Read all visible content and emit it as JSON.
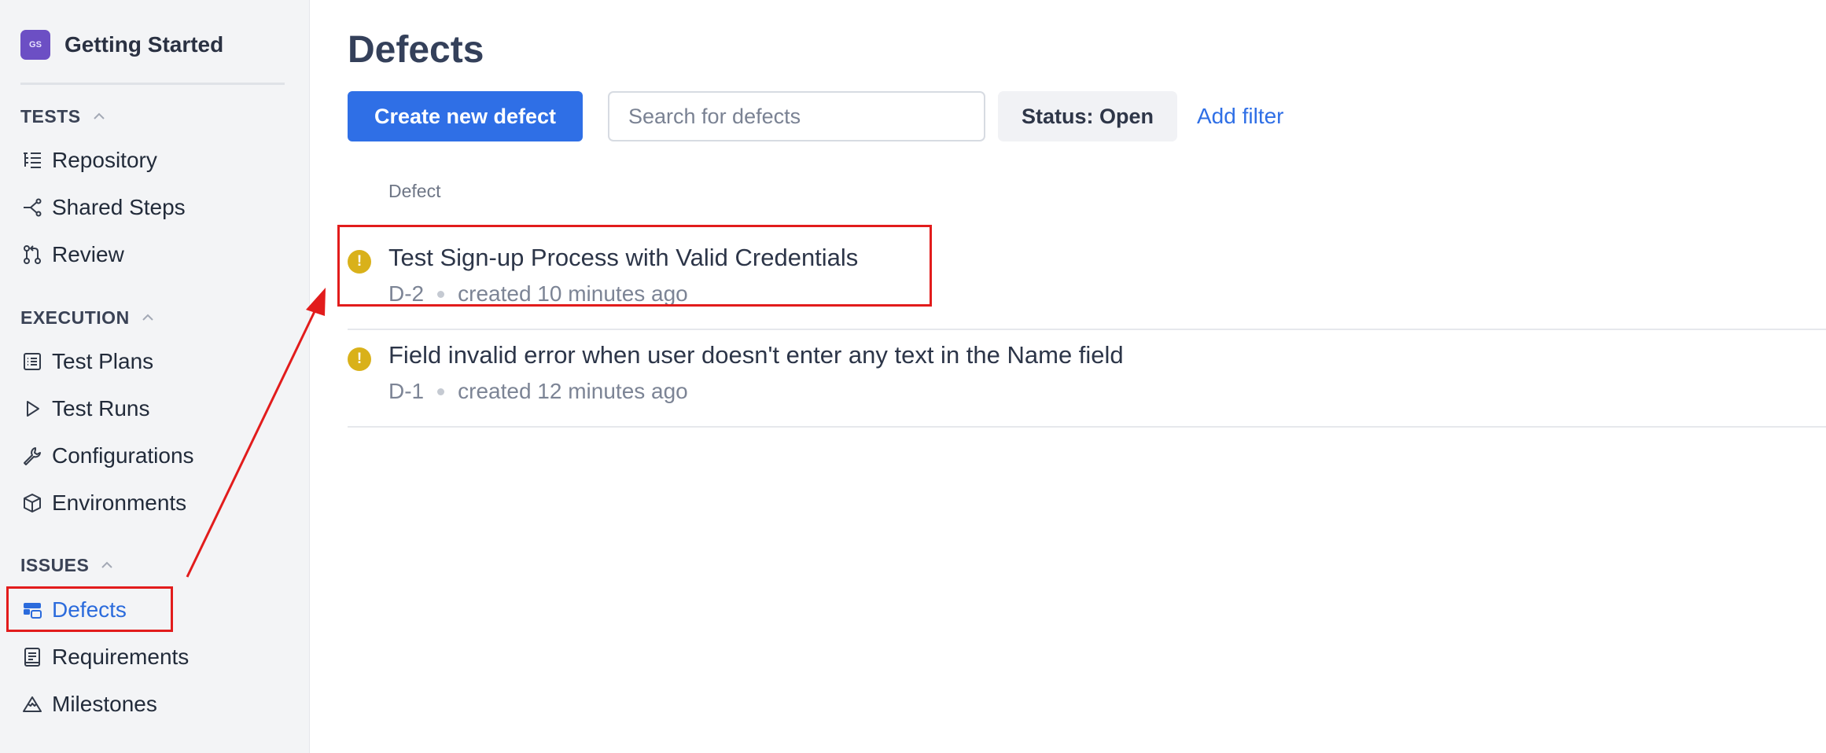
{
  "project": {
    "initials": "GS",
    "name": "Getting Started"
  },
  "sidebar": {
    "sections": [
      {
        "title": "TESTS",
        "items": [
          {
            "label": "Repository",
            "icon": "tree-list-icon"
          },
          {
            "label": "Shared Steps",
            "icon": "share-steps-icon"
          },
          {
            "label": "Review",
            "icon": "git-pull-request-icon"
          }
        ]
      },
      {
        "title": "EXECUTION",
        "items": [
          {
            "label": "Test Plans",
            "icon": "list-box-icon"
          },
          {
            "label": "Test Runs",
            "icon": "play-icon"
          },
          {
            "label": "Configurations",
            "icon": "wrench-icon"
          },
          {
            "label": "Environments",
            "icon": "cube-icon"
          }
        ]
      },
      {
        "title": "ISSUES",
        "items": [
          {
            "label": "Defects",
            "icon": "defects-icon",
            "active": true
          },
          {
            "label": "Requirements",
            "icon": "document-icon"
          },
          {
            "label": "Milestones",
            "icon": "mountain-icon"
          }
        ]
      }
    ]
  },
  "main": {
    "title": "Defects",
    "create_button": "Create new defect",
    "search_placeholder": "Search for defects",
    "status_filter": "Status: Open",
    "add_filter": "Add filter",
    "column_header": "Defect",
    "defects": [
      {
        "title": "Test Sign-up Process with Valid Credentials",
        "id": "D-2",
        "created": "created 10 minutes ago"
      },
      {
        "title": "Field invalid error when user doesn't enter any text in the Name field",
        "id": "D-1",
        "created": "created 12 minutes ago"
      }
    ]
  },
  "colors": {
    "accent": "#2f6fe6",
    "annotation": "#e21c1c",
    "warning": "#d9b11a",
    "sidebar_bg": "#f3f4f6"
  }
}
